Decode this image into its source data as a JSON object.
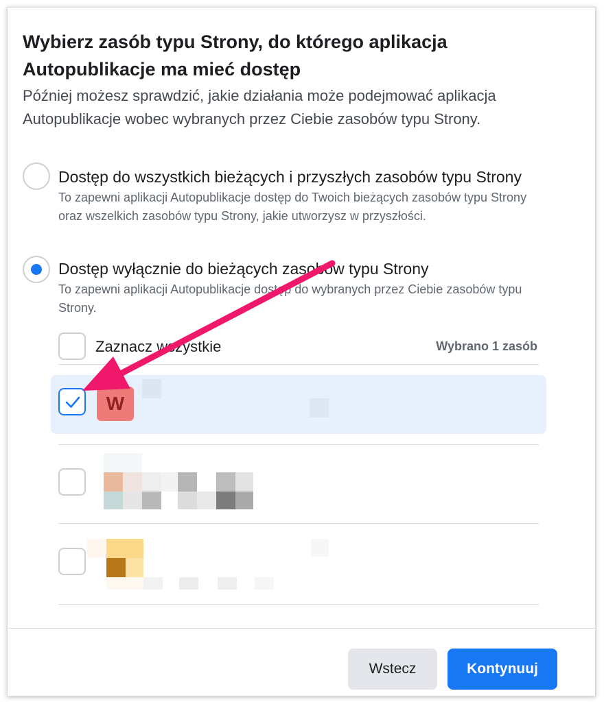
{
  "dialog": {
    "title": "Wybierz zasób typu Strony, do którego aplikacja Autopublikacje ma mieć dostęp",
    "subtitle": "Później możesz sprawdzić, jakie działania może podejmować aplikacja Autopublikacje wobec wybranych przez Ciebie zasobów typu Strony."
  },
  "options": [
    {
      "label": "Dostęp do wszystkich bieżących i przyszłych zasobów typu Strony",
      "description": "To zapewni aplikacji Autopublikacje dostęp do Twoich bieżących zasobów typu Strony oraz wszelkich zasobów typu Strony, jakie utworzysz w przyszłości.",
      "selected": false
    },
    {
      "label": "Dostęp wyłącznie do bieżących zasobów typu Strony",
      "description": "To zapewni aplikacji Autopublikacje dostęp do wybranych przez Ciebie zasobów typu Strony.",
      "selected": true
    }
  ],
  "list": {
    "select_all_label": "Zaznacz wszystkie",
    "selected_count": "Wybrano 1 zasób",
    "items": [
      {
        "icon_letter": "W",
        "checked": true
      },
      {
        "checked": false
      },
      {
        "checked": false
      }
    ]
  },
  "footer": {
    "back_label": "Wstecz",
    "continue_label": "Kontynuuj"
  },
  "colors": {
    "accent": "#1877f2",
    "selected_row": "#e7f0fd",
    "annotation_arrow": "#f0186a",
    "page_icon": "#ee7b77"
  },
  "icons": [
    "checkmark-icon",
    "annotation-arrow"
  ]
}
